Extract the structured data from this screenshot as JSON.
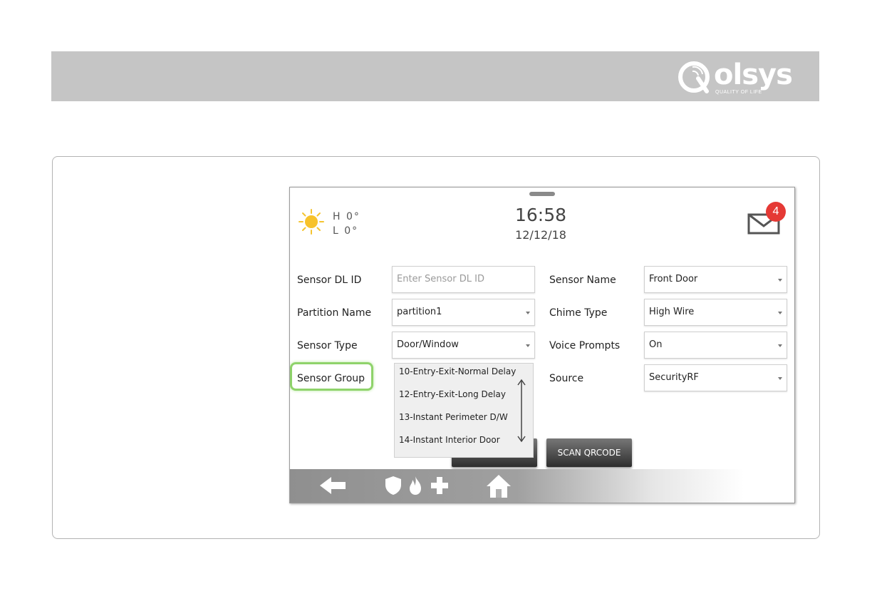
{
  "brand": {
    "name": "olsys",
    "tagline": "QUALITY OF LIFE"
  },
  "status": {
    "high_temp": "H 0°",
    "low_temp": "L 0°",
    "time": "16:58",
    "date": "12/12/18",
    "message_count": "4"
  },
  "form": {
    "sensor_dl_id": {
      "label": "Sensor DL ID",
      "placeholder": "Enter Sensor DL ID"
    },
    "partition_name": {
      "label": "Partition Name",
      "value": "partition1"
    },
    "sensor_type": {
      "label": "Sensor Type",
      "value": "Door/Window"
    },
    "sensor_group": {
      "label": "Sensor Group"
    },
    "sensor_name": {
      "label": "Sensor Name",
      "value": "Front Door"
    },
    "chime_type": {
      "label": "Chime Type",
      "value": "High Wire"
    },
    "voice_prompts": {
      "label": "Voice Prompts",
      "value": "On"
    },
    "source": {
      "label": "Source",
      "value": "SecurityRF"
    }
  },
  "dropdown": {
    "options": [
      "10-Entry-Exit-Normal Delay",
      "12-Entry-Exit-Long Delay",
      "13-Instant Perimeter D/W",
      "14-Instant Interior Door"
    ]
  },
  "buttons": {
    "scan_qrcode": "SCAN QRCODE"
  },
  "icons": {
    "weather": "sun-icon",
    "messages": "envelope-icon",
    "back": "back-arrow-icon",
    "security": "shield-icon",
    "fire": "flame-icon",
    "medical": "plus-icon",
    "home": "home-icon",
    "scroll": "double-arrow-icon"
  },
  "colors": {
    "highlight": "#8fd36b",
    "badge": "#e53935",
    "header": "#c5c5c5"
  }
}
